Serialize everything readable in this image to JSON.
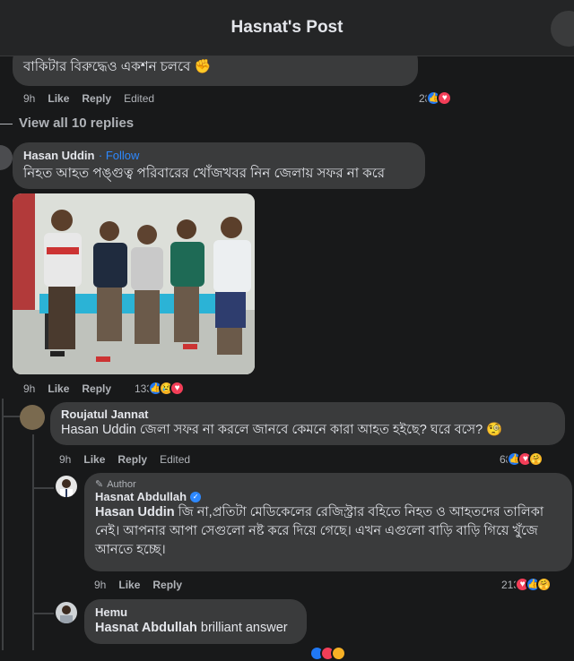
{
  "header": {
    "title": "Hasnat's Post"
  },
  "comments": {
    "top": {
      "text": "বাকিটার বিরুদ্ধেও একশন চলবে",
      "time": "9h",
      "like": "Like",
      "reply": "Reply",
      "edited": "Edited",
      "count": "28"
    },
    "view_replies": "View all 10 replies",
    "hasan": {
      "name": "Hasan Uddin",
      "follow": "· Follow",
      "text": "নিহত আহত পঙ্গুত্ব পরিবারের খোঁজখবর নিন জেলায় সফর না করে",
      "time": "9h",
      "like": "Like",
      "reply": "Reply",
      "count": "133"
    },
    "roujatul": {
      "name": "Roujatul Jannat",
      "text": "Hasan Uddin জেলা সফর না করলে জানবে কেমনে কারা আহত হইছে? ঘরে বসে?",
      "time": "9h",
      "like": "Like",
      "reply": "Reply",
      "edited": "Edited",
      "count": "68"
    },
    "hasnat": {
      "badge": "Author",
      "name": "Hasnat Abdullah",
      "mention": "Hasan Uddin",
      "text": "জি না,প্রতিটা মেডিকেলের রেজিস্ট্রার বহিতে নিহত ও আহতদের তালিকা নেই। আপনার আপা সেগুলো নষ্ট করে দিয়ে গেছে। এখন এগুলো বাড়ি বাড়ি গিয়ে খুঁজে আনতে হচ্ছে।",
      "time": "9h",
      "like": "Like",
      "reply": "Reply",
      "count": "213"
    },
    "hemu": {
      "name": "Hemu",
      "mention": "Hasnat Abdullah",
      "text": "brilliant answer"
    }
  },
  "colors": {
    "background": "#18191a",
    "bubble": "#3a3b3c",
    "link": "#2d88ff"
  }
}
